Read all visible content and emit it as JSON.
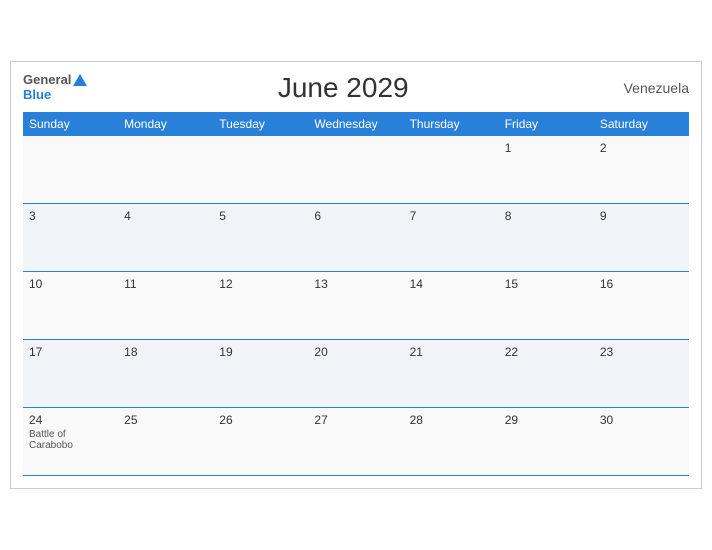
{
  "header": {
    "logo_general": "General",
    "logo_blue": "Blue",
    "title": "June 2029",
    "country": "Venezuela"
  },
  "weekdays": [
    "Sunday",
    "Monday",
    "Tuesday",
    "Wednesday",
    "Thursday",
    "Friday",
    "Saturday"
  ],
  "weeks": [
    [
      {
        "day": "",
        "event": ""
      },
      {
        "day": "",
        "event": ""
      },
      {
        "day": "",
        "event": ""
      },
      {
        "day": "",
        "event": ""
      },
      {
        "day": "",
        "event": ""
      },
      {
        "day": "1",
        "event": ""
      },
      {
        "day": "2",
        "event": ""
      }
    ],
    [
      {
        "day": "3",
        "event": ""
      },
      {
        "day": "4",
        "event": ""
      },
      {
        "day": "5",
        "event": ""
      },
      {
        "day": "6",
        "event": ""
      },
      {
        "day": "7",
        "event": ""
      },
      {
        "day": "8",
        "event": ""
      },
      {
        "day": "9",
        "event": ""
      }
    ],
    [
      {
        "day": "10",
        "event": ""
      },
      {
        "day": "11",
        "event": ""
      },
      {
        "day": "12",
        "event": ""
      },
      {
        "day": "13",
        "event": ""
      },
      {
        "day": "14",
        "event": ""
      },
      {
        "day": "15",
        "event": ""
      },
      {
        "day": "16",
        "event": ""
      }
    ],
    [
      {
        "day": "17",
        "event": ""
      },
      {
        "day": "18",
        "event": ""
      },
      {
        "day": "19",
        "event": ""
      },
      {
        "day": "20",
        "event": ""
      },
      {
        "day": "21",
        "event": ""
      },
      {
        "day": "22",
        "event": ""
      },
      {
        "day": "23",
        "event": ""
      }
    ],
    [
      {
        "day": "24",
        "event": "Battle of Carabobo"
      },
      {
        "day": "25",
        "event": ""
      },
      {
        "day": "26",
        "event": ""
      },
      {
        "day": "27",
        "event": ""
      },
      {
        "day": "28",
        "event": ""
      },
      {
        "day": "29",
        "event": ""
      },
      {
        "day": "30",
        "event": ""
      }
    ]
  ]
}
